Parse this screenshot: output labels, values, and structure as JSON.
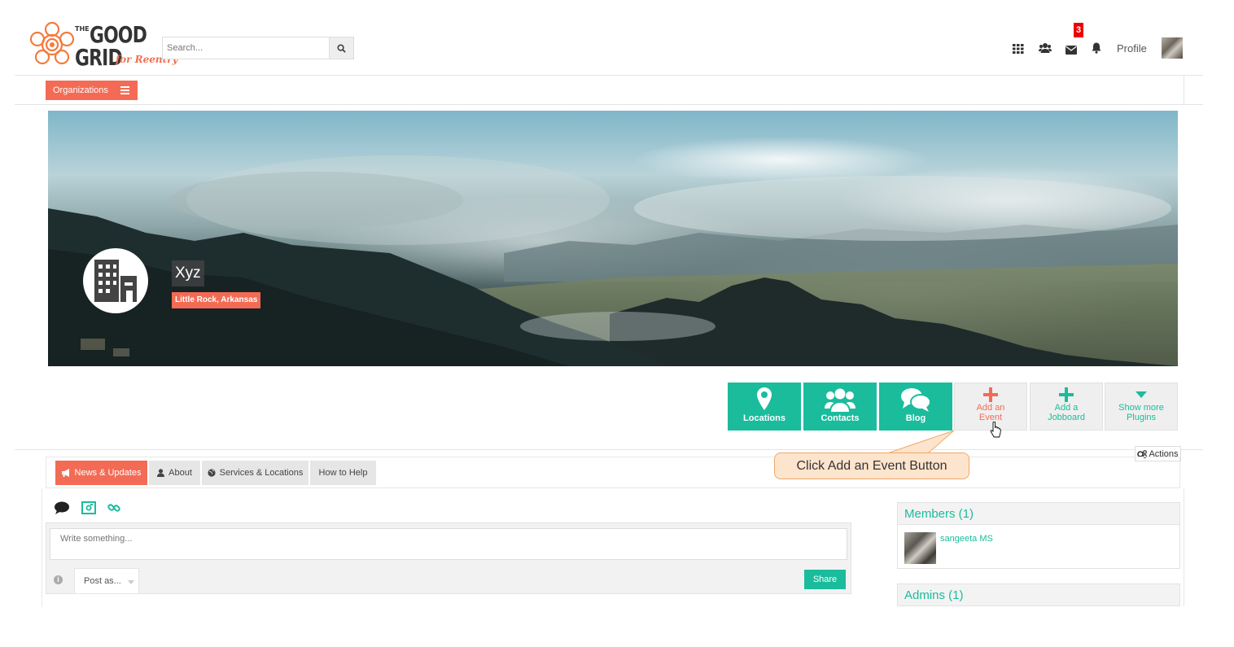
{
  "brand": {
    "logo_the": "THE",
    "logo_good": "GOOD",
    "logo_grid": "GRID",
    "logo_tagline": "for Reentry",
    "accent": "#f36b55",
    "teal": "#1abc9c"
  },
  "search": {
    "placeholder": "Search..."
  },
  "topnav": {
    "icons": [
      "grid-icon",
      "users-icon",
      "envelope-icon",
      "bell-icon"
    ],
    "messages_badge": "3",
    "profile_label": "Profile"
  },
  "subnav": {
    "organizations_label": "Organizations"
  },
  "organization": {
    "name": "Xyz",
    "location": "Little Rock, Arkansas"
  },
  "plugins": [
    {
      "label": "Locations",
      "icon": "map-marker-icon",
      "style": "teal"
    },
    {
      "label": "Contacts",
      "icon": "users-icon",
      "style": "teal"
    },
    {
      "label": "Blog",
      "icon": "comments-icon",
      "style": "teal"
    },
    {
      "label": "Add an\nEvent",
      "icon": "plus-icon",
      "style": "gray-accent"
    },
    {
      "label": "Add a\nJobboard",
      "icon": "plus-icon",
      "style": "gray-teal"
    },
    {
      "label": "Show more\nPlugins",
      "icon": "caret-down-icon",
      "style": "gray-teal"
    }
  ],
  "actions_label": "Actions",
  "tabs": [
    {
      "label": "News & Updates",
      "active": true
    },
    {
      "label": "About",
      "active": false
    },
    {
      "label": "Services & Locations",
      "active": false
    },
    {
      "label": "How to Help",
      "active": false
    }
  ],
  "callout": {
    "text": "Click Add an Event Button"
  },
  "post": {
    "placeholder": "Write something...",
    "post_as_label": "Post as...",
    "share_label": "Share"
  },
  "members": {
    "title": "Members (1)",
    "list": [
      {
        "name": "sangeeta MS"
      }
    ]
  },
  "admins": {
    "title": "Admins (1)"
  }
}
